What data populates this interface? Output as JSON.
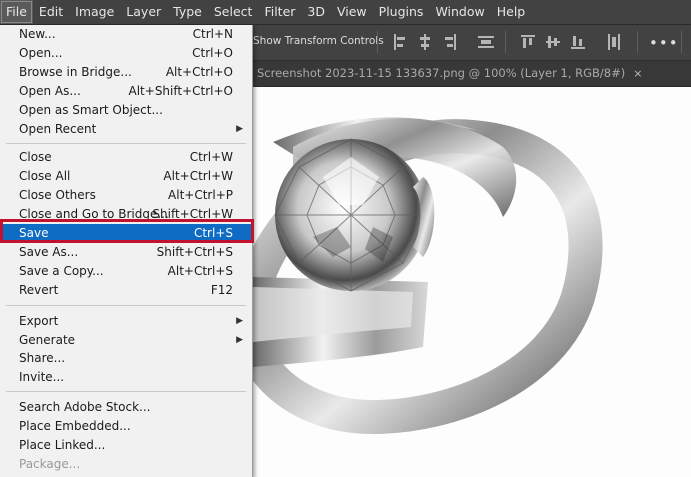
{
  "menubar": {
    "items": [
      "File",
      "Edit",
      "Image",
      "Layer",
      "Type",
      "Select",
      "Filter",
      "3D",
      "View",
      "Plugins",
      "Window",
      "Help"
    ]
  },
  "options_bar": {
    "show_transform_label": "Show Transform Controls",
    "more_label": "•••"
  },
  "document_tab": {
    "title": "Screenshot 2023-11-15 133637.png @ 100% (Layer 1, RGB/8#)",
    "close_label": "×"
  },
  "file_menu": {
    "items": [
      {
        "label": "New...",
        "shortcut": "Ctrl+N"
      },
      {
        "label": "Open...",
        "shortcut": "Ctrl+O"
      },
      {
        "label": "Browse in Bridge...",
        "shortcut": "Alt+Ctrl+O"
      },
      {
        "label": "Open As...",
        "shortcut": "Alt+Shift+Ctrl+O"
      },
      {
        "label": "Open as Smart Object...",
        "shortcut": ""
      },
      {
        "label": "Open Recent",
        "shortcut": "",
        "submenu": true
      },
      {
        "label": "Close",
        "shortcut": "Ctrl+W"
      },
      {
        "label": "Close All",
        "shortcut": "Alt+Ctrl+W"
      },
      {
        "label": "Close Others",
        "shortcut": "Alt+Ctrl+P"
      },
      {
        "label": "Close and Go to Bridge...",
        "shortcut": "Shift+Ctrl+W"
      },
      {
        "label": "Save",
        "shortcut": "Ctrl+S",
        "selected": true
      },
      {
        "label": "Save As...",
        "shortcut": "Shift+Ctrl+S"
      },
      {
        "label": "Save a Copy...",
        "shortcut": "Alt+Ctrl+S"
      },
      {
        "label": "Revert",
        "shortcut": "F12"
      },
      {
        "label": "Export",
        "shortcut": "",
        "submenu": true
      },
      {
        "label": "Generate",
        "shortcut": "",
        "submenu": true
      },
      {
        "label": "Share...",
        "shortcut": ""
      },
      {
        "label": "Invite...",
        "shortcut": ""
      },
      {
        "label": "Search Adobe Stock...",
        "shortcut": ""
      },
      {
        "label": "Place Embedded...",
        "shortcut": ""
      },
      {
        "label": "Place Linked...",
        "shortcut": ""
      },
      {
        "label": "Package...",
        "shortcut": "",
        "disabled": true
      }
    ],
    "submenu_glyph": "▶"
  },
  "colors": {
    "selection": "#0f6cc4",
    "highlight_border": "#c1122e"
  }
}
